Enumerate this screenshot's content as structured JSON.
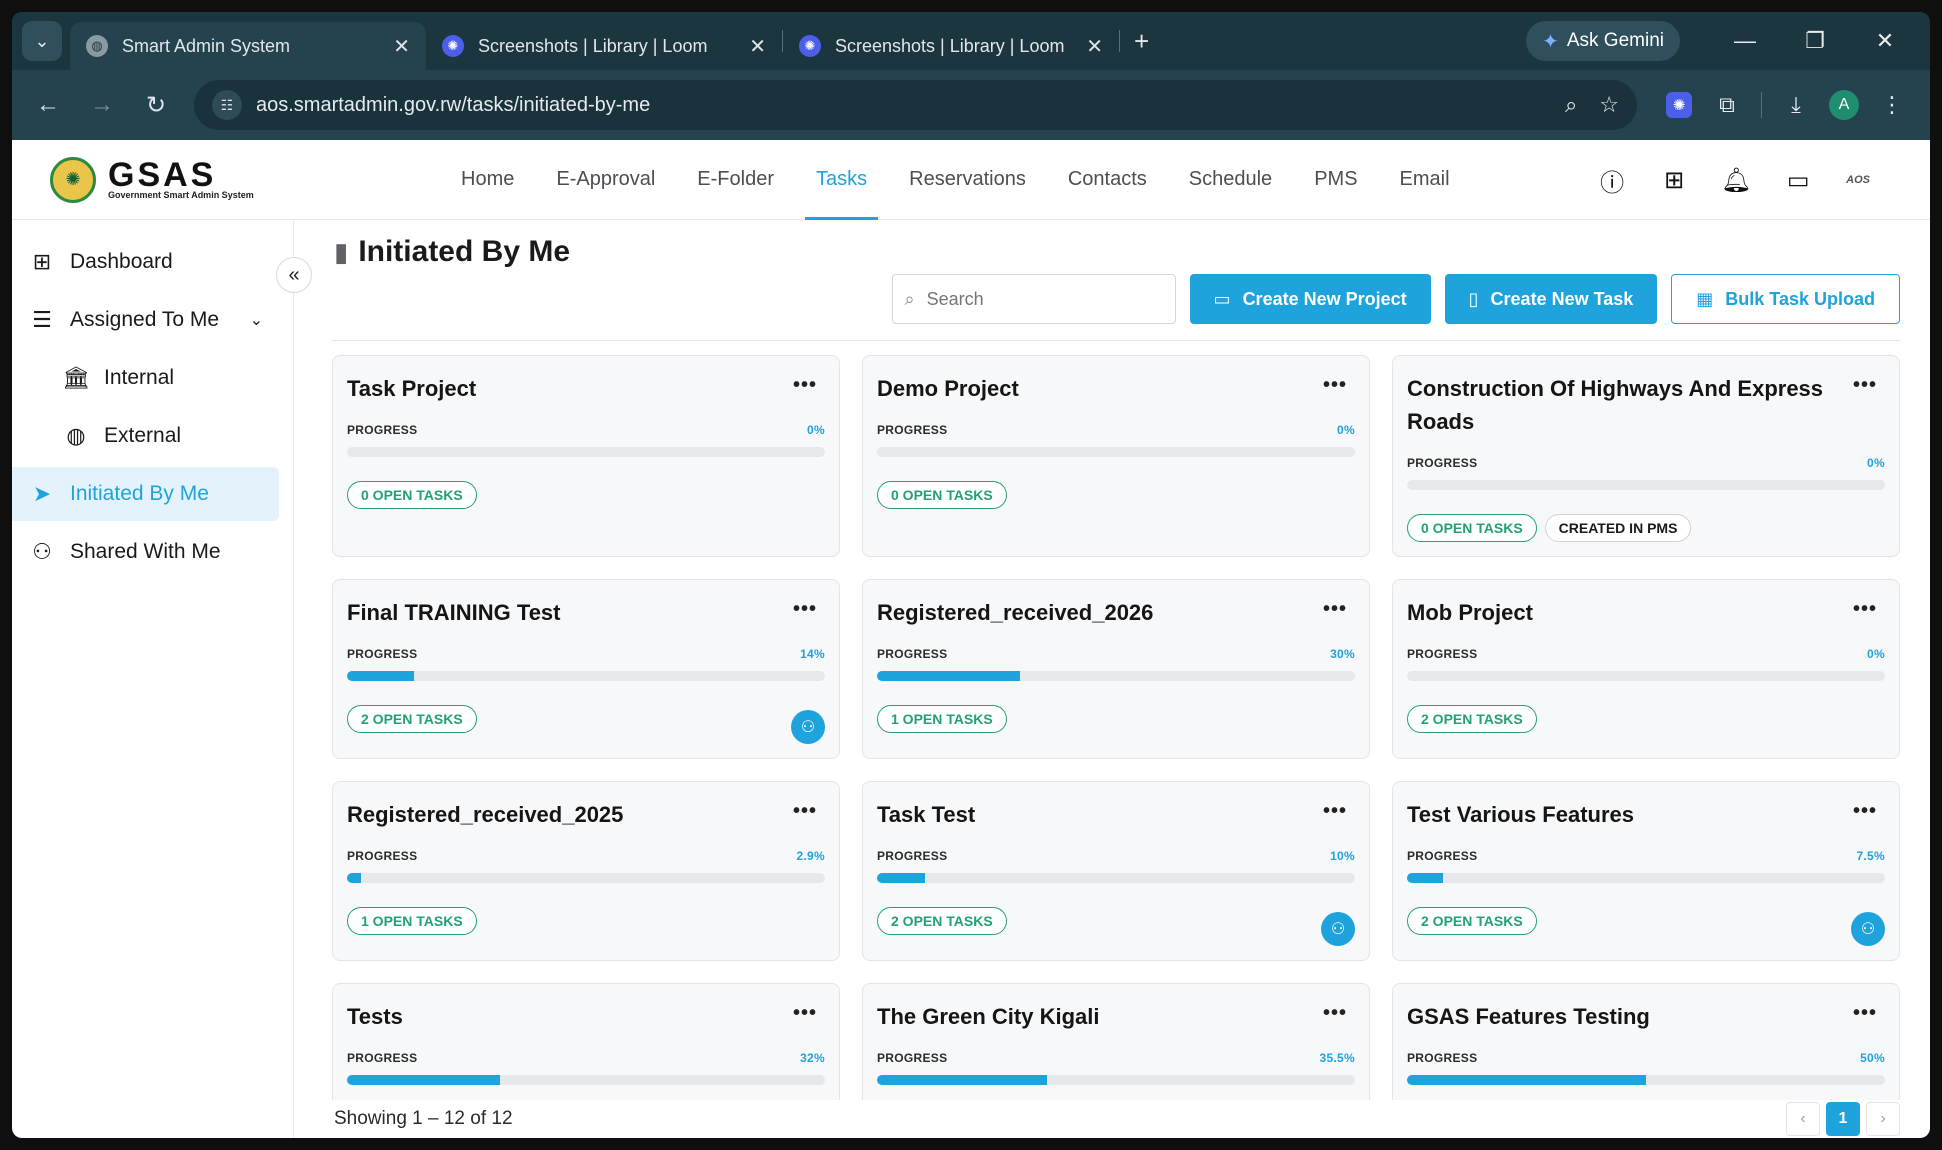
{
  "browser": {
    "tabs": [
      {
        "title": "Smart Admin System",
        "icon": "globe-icon",
        "active": true
      },
      {
        "title": "Screenshots | Library | Loom",
        "icon": "loom-icon",
        "active": false
      },
      {
        "title": "Screenshots | Library | Loom",
        "icon": "loom-icon",
        "active": false
      }
    ],
    "gemini_label": "Ask Gemini",
    "url": "aos.smartadmin.gov.rw/tasks/initiated-by-me",
    "profile_initial": "A"
  },
  "app": {
    "brand": {
      "name": "GSAS",
      "tagline": "Government Smart Admin System"
    },
    "nav": [
      "Home",
      "E-Approval",
      "E-Folder",
      "Tasks",
      "Reservations",
      "Contacts",
      "Schedule",
      "PMS",
      "Email"
    ],
    "active_nav": "Tasks",
    "user_badge": "AOS"
  },
  "sidebar": {
    "items": [
      {
        "label": "Dashboard",
        "icon": "dashboard-icon"
      },
      {
        "label": "Assigned To Me",
        "icon": "checklist-icon"
      },
      {
        "label": "Internal",
        "icon": "building-icon"
      },
      {
        "label": "External",
        "icon": "globe-icon"
      },
      {
        "label": "Initiated By Me",
        "icon": "send-icon"
      },
      {
        "label": "Shared With Me",
        "icon": "group-icon"
      }
    ],
    "active": "Initiated By Me"
  },
  "page": {
    "title": "Initiated By Me",
    "search_placeholder": "Search",
    "buttons": {
      "create_project": "Create New Project",
      "create_task": "Create New Task",
      "bulk_upload": "Bulk Task Upload"
    },
    "progress_label": "PROGRESS",
    "projects": [
      {
        "title": "Task Project",
        "progress_label": "0%",
        "progress": 0,
        "open_tasks": "0 OPEN TASKS",
        "extra_badge": "",
        "assignee": false
      },
      {
        "title": "Demo Project",
        "progress_label": "0%",
        "progress": 0,
        "open_tasks": "0 OPEN TASKS",
        "extra_badge": "",
        "assignee": false
      },
      {
        "title": "Construction Of Highways And Express Roads",
        "progress_label": "0%",
        "progress": 0,
        "open_tasks": "0 OPEN TASKS",
        "extra_badge": "CREATED IN PMS",
        "assignee": false
      },
      {
        "title": "Final TRAINING Test",
        "progress_label": "14%",
        "progress": 14,
        "open_tasks": "2 OPEN TASKS",
        "extra_badge": "",
        "assignee": true
      },
      {
        "title": "Registered_received_2026",
        "progress_label": "30%",
        "progress": 30,
        "open_tasks": "1 OPEN TASKS",
        "extra_badge": "",
        "assignee": false
      },
      {
        "title": "Mob Project",
        "progress_label": "0%",
        "progress": 0,
        "open_tasks": "2 OPEN TASKS",
        "extra_badge": "",
        "assignee": false
      },
      {
        "title": "Registered_received_2025",
        "progress_label": "2.9%",
        "progress": 2.9,
        "open_tasks": "1 OPEN TASKS",
        "extra_badge": "",
        "assignee": false
      },
      {
        "title": "Task Test",
        "progress_label": "10%",
        "progress": 10,
        "open_tasks": "2 OPEN TASKS",
        "extra_badge": "",
        "assignee": true
      },
      {
        "title": "Test Various Features",
        "progress_label": "7.5%",
        "progress": 7.5,
        "open_tasks": "2 OPEN TASKS",
        "extra_badge": "",
        "assignee": true
      },
      {
        "title": "Tests",
        "progress_label": "32%",
        "progress": 32,
        "open_tasks": "",
        "extra_badge": "",
        "assignee": false
      },
      {
        "title": "The Green City Kigali",
        "progress_label": "35.5%",
        "progress": 35.5,
        "open_tasks": "",
        "extra_badge": "",
        "assignee": false
      },
      {
        "title": "GSAS Features Testing",
        "progress_label": "50%",
        "progress": 50,
        "open_tasks": "",
        "extra_badge": "",
        "assignee": false
      }
    ],
    "footer": {
      "showing": "Showing 1 – 12 of 12",
      "current_page": "1"
    }
  }
}
